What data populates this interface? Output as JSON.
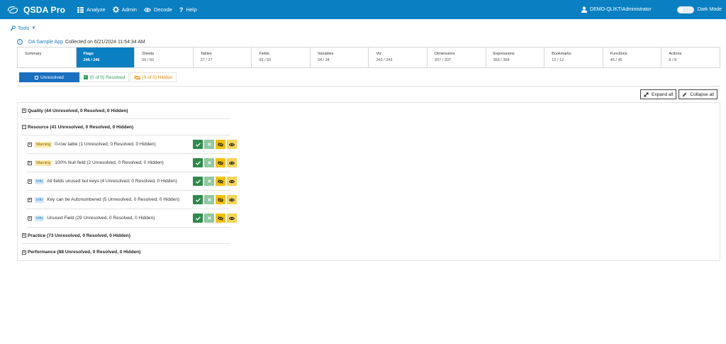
{
  "app": {
    "name": "QSDA Pro",
    "logo_icon": "qsda-swoosh-logo"
  },
  "nav": {
    "analyze": "Analyze",
    "admin": "Admin",
    "decode": "Decode",
    "help": "Help"
  },
  "user": {
    "name": "DEMO-QLIKT\\Administrator",
    "dark_mode_label": "Dark Mode",
    "dark_mode_on": false
  },
  "tools": {
    "label": "Tools"
  },
  "appinfo": {
    "app_name": "DA Sample App",
    "collected": "Collected on 6/21/2024 11:54:34 AM"
  },
  "tabs": [
    {
      "label": "Summary",
      "count": ""
    },
    {
      "label": "Flags",
      "count": "246 / 246",
      "active": true
    },
    {
      "label": "Sheets",
      "count": "50 / 50"
    },
    {
      "label": "Tables",
      "count": "27 / 27"
    },
    {
      "label": "Fields",
      "count": "93 / 93"
    },
    {
      "label": "Variables",
      "count": "34 / 34"
    },
    {
      "label": "Viz",
      "count": "243 / 243"
    },
    {
      "label": "Dimensions",
      "count": "207 / 207"
    },
    {
      "label": "Expressions",
      "count": "368 / 368"
    },
    {
      "label": "Bookmarks",
      "count": "12 / 12"
    },
    {
      "label": "Functions",
      "count": "45 / 45"
    },
    {
      "label": "Actions",
      "count": "8 / 8"
    }
  ],
  "filters": {
    "unresolved": "Unresolved",
    "resolved": "(0 of 0) Resolved",
    "hidden": "(0 of 0) Hidden"
  },
  "controls": {
    "expand_all": "Expand all",
    "collapse_all": "Collapse all"
  },
  "sections": {
    "quality": "Quality (44 Unresolved, 0 Resolved, 0 Hidden)",
    "resource": "Resource (41 Unresolved, 0 Resolved, 0 Hidden)",
    "practice": "Practice (73 Unresolved, 0 Resolved, 0 Hidden)",
    "performance": "Performance (88 Unresolved, 0 Resolved, 0 Hidden)"
  },
  "resource_rows": [
    {
      "level": "Warning",
      "text": "0-row table (1 Unresolved, 0 Resolved, 0 Hidden)"
    },
    {
      "level": "Warning",
      "text": "100% Null field (2 Unresolved, 0 Resolved, 0 Hidden)"
    },
    {
      "level": "Info",
      "text": "All fields unused but keys (4 Unresolved, 0 Resolved, 0 Hidden)"
    },
    {
      "level": "Info",
      "text": "Key can be Autonumbered (5 Unresolved, 0 Resolved, 0 Hidden)"
    },
    {
      "level": "Info",
      "text": "Unused Field (29 Unresolved, 0 Resolved, 0 Hidden)"
    }
  ],
  "colors": {
    "topbar": "#0a80c2",
    "active_tab": "#0a80c2",
    "resolve": "#2d8b4c",
    "hide": "#f2c200"
  }
}
